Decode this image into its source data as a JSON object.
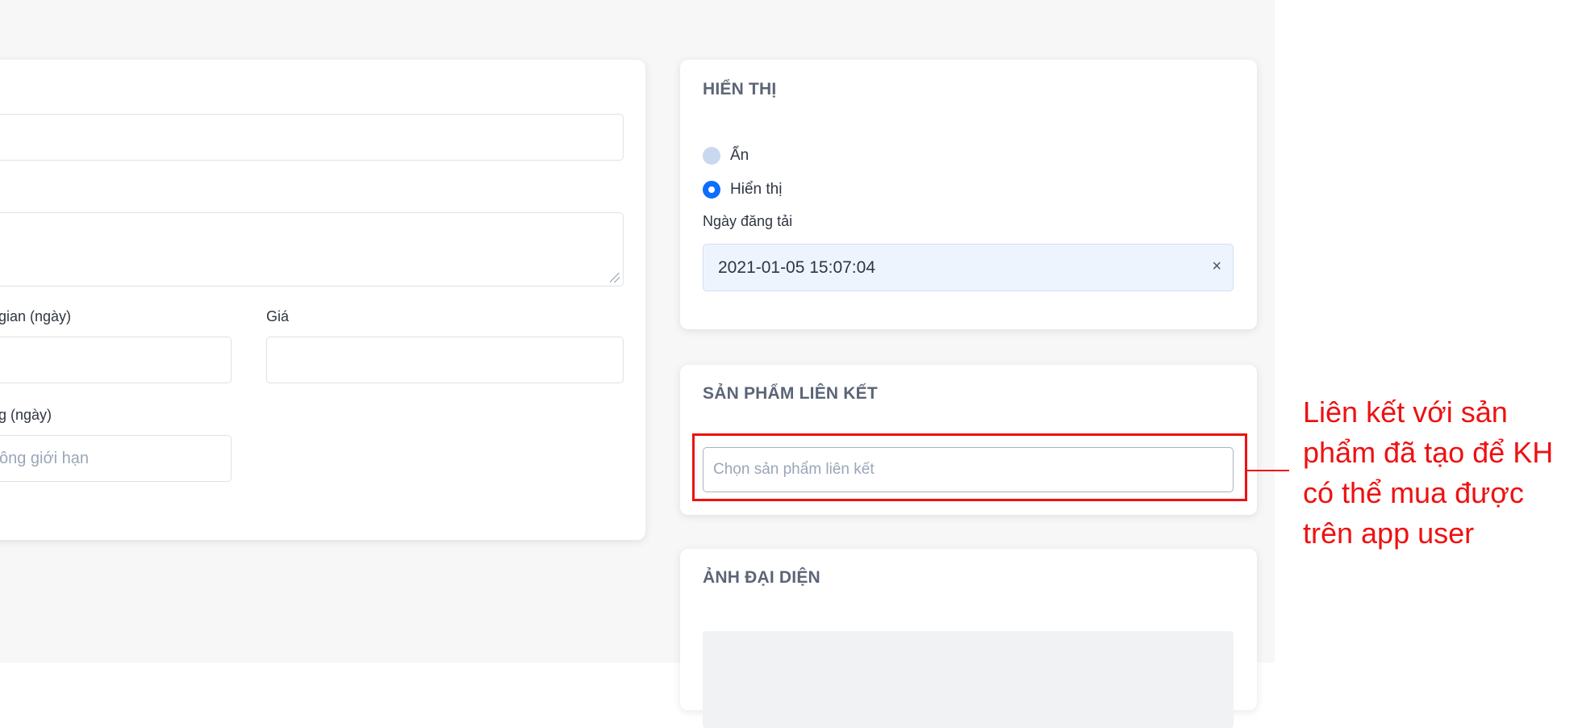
{
  "left_form": {
    "duration_label": "gian (ngày)",
    "price_label": "Giá",
    "limit_label": "g (ngày)",
    "limit_placeholder": "ông giới hạn"
  },
  "display_card": {
    "title": "HIỂN THỊ",
    "radio_hidden_label": "Ẩn",
    "radio_visible_label": "Hiển thị",
    "selected": "Hiển thị",
    "publish_date_label": "Ngày đăng tải",
    "publish_date_value": "2021-01-05 15:07:04",
    "clear_symbol": "×"
  },
  "linked_card": {
    "title": "SẢN PHẨM LIÊN KẾT",
    "select_placeholder": "Chọn sản phẩm liên kết"
  },
  "avatar_card": {
    "title": "ẢNH ĐẠI DIỆN"
  },
  "annotation": {
    "text": "Liên kết với sản phẩm đã tạo để KH có thể mua được trên app user",
    "color": "#ee1111"
  },
  "colors": {
    "accent": "#0d6efd",
    "page_bg": "#f7f7f7",
    "date_bg": "#eef4fd"
  }
}
